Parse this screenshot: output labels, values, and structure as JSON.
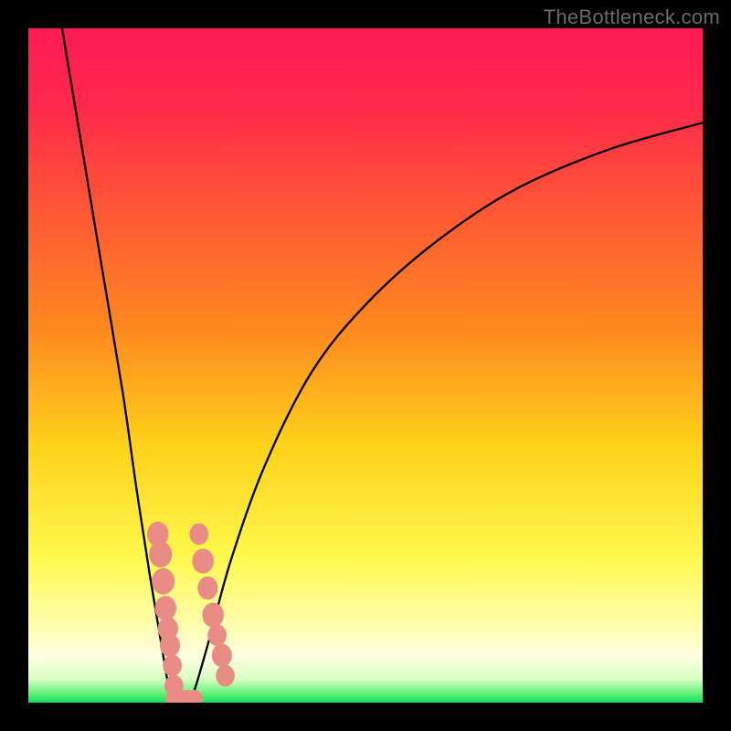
{
  "watermark": "TheBottleneck.com",
  "colors": {
    "frame": "#000000",
    "curve": "#000000",
    "marker_fill": "#e98c86",
    "bottom_band": "#10e060",
    "gradient_stops": [
      {
        "offset": 0.0,
        "color": "#ff1a55"
      },
      {
        "offset": 0.12,
        "color": "#ff2a4a"
      },
      {
        "offset": 0.28,
        "color": "#ff5a33"
      },
      {
        "offset": 0.45,
        "color": "#ff8a1f"
      },
      {
        "offset": 0.62,
        "color": "#ffd21a"
      },
      {
        "offset": 0.78,
        "color": "#fff84a"
      },
      {
        "offset": 0.88,
        "color": "#ffffa8"
      },
      {
        "offset": 0.93,
        "color": "#ffffe0"
      },
      {
        "offset": 0.965,
        "color": "#d8ffc4"
      },
      {
        "offset": 0.985,
        "color": "#6cf27d"
      },
      {
        "offset": 1.0,
        "color": "#10e060"
      }
    ]
  },
  "chart_data": {
    "type": "line",
    "title": "",
    "xlabel": "",
    "ylabel": "",
    "xlim": [
      0,
      100
    ],
    "ylim": [
      0,
      100
    ],
    "series": [
      {
        "name": "left-branch",
        "x": [
          5,
          8,
          11,
          14,
          16,
          18,
          19.5,
          20.5,
          21.0,
          21.5
        ],
        "y": [
          100,
          82,
          64,
          46,
          32,
          19,
          10,
          4,
          1.5,
          0
        ]
      },
      {
        "name": "right-branch",
        "x": [
          24,
          25,
          27,
          30,
          35,
          42,
          50,
          60,
          72,
          86,
          100
        ],
        "y": [
          0,
          3,
          10,
          21,
          35,
          49,
          59,
          68,
          76,
          82,
          86
        ]
      }
    ],
    "markers": [
      {
        "series": "left-branch",
        "x": 19.2,
        "y": 25,
        "r": 1.6
      },
      {
        "series": "left-branch",
        "x": 19.6,
        "y": 22,
        "r": 1.7
      },
      {
        "series": "left-branch",
        "x": 20.0,
        "y": 18,
        "r": 1.7
      },
      {
        "series": "left-branch",
        "x": 20.35,
        "y": 14,
        "r": 1.6
      },
      {
        "series": "left-branch",
        "x": 20.7,
        "y": 11,
        "r": 1.5
      },
      {
        "series": "left-branch",
        "x": 21.0,
        "y": 8.5,
        "r": 1.5
      },
      {
        "series": "left-branch",
        "x": 21.35,
        "y": 5.5,
        "r": 1.4
      },
      {
        "series": "left-branch",
        "x": 21.6,
        "y": 2.5,
        "r": 1.4
      },
      {
        "series": "right-branch",
        "x": 25.3,
        "y": 25,
        "r": 1.4
      },
      {
        "series": "right-branch",
        "x": 25.9,
        "y": 21,
        "r": 1.6
      },
      {
        "series": "right-branch",
        "x": 26.6,
        "y": 17,
        "r": 1.5
      },
      {
        "series": "right-branch",
        "x": 27.4,
        "y": 13,
        "r": 1.6
      },
      {
        "series": "right-branch",
        "x": 28.0,
        "y": 10,
        "r": 1.4
      },
      {
        "series": "right-branch",
        "x": 28.7,
        "y": 7,
        "r": 1.5
      },
      {
        "series": "right-branch",
        "x": 29.2,
        "y": 4,
        "r": 1.4
      },
      {
        "series": "bottom",
        "x": 21.6,
        "y": 0.4,
        "r": 1.3
      },
      {
        "series": "bottom",
        "x": 22.6,
        "y": 0.4,
        "r": 1.3
      },
      {
        "series": "bottom",
        "x": 23.6,
        "y": 0.4,
        "r": 1.3
      },
      {
        "series": "bottom",
        "x": 24.6,
        "y": 0.4,
        "r": 1.3
      }
    ]
  }
}
